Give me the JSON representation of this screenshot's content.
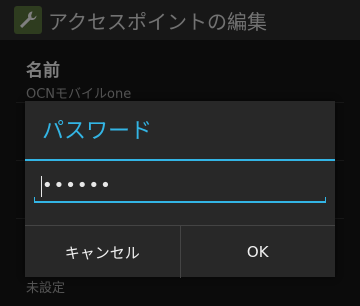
{
  "action_bar": {
    "title": "アクセスポイントの編集",
    "icon": "wrench-icon"
  },
  "preferences": [
    {
      "title": "名前",
      "summary": "OCNモバイルone"
    }
  ],
  "background_bottom_summary": "未設定",
  "dialog": {
    "title": "パスワード",
    "password_masked": "••••••",
    "cancel_label": "キャンセル",
    "ok_label": "OK"
  },
  "colors": {
    "accent": "#33b5e5",
    "background": "#151515",
    "dialog_background": "#282828",
    "icon_background": "#546e3a"
  }
}
